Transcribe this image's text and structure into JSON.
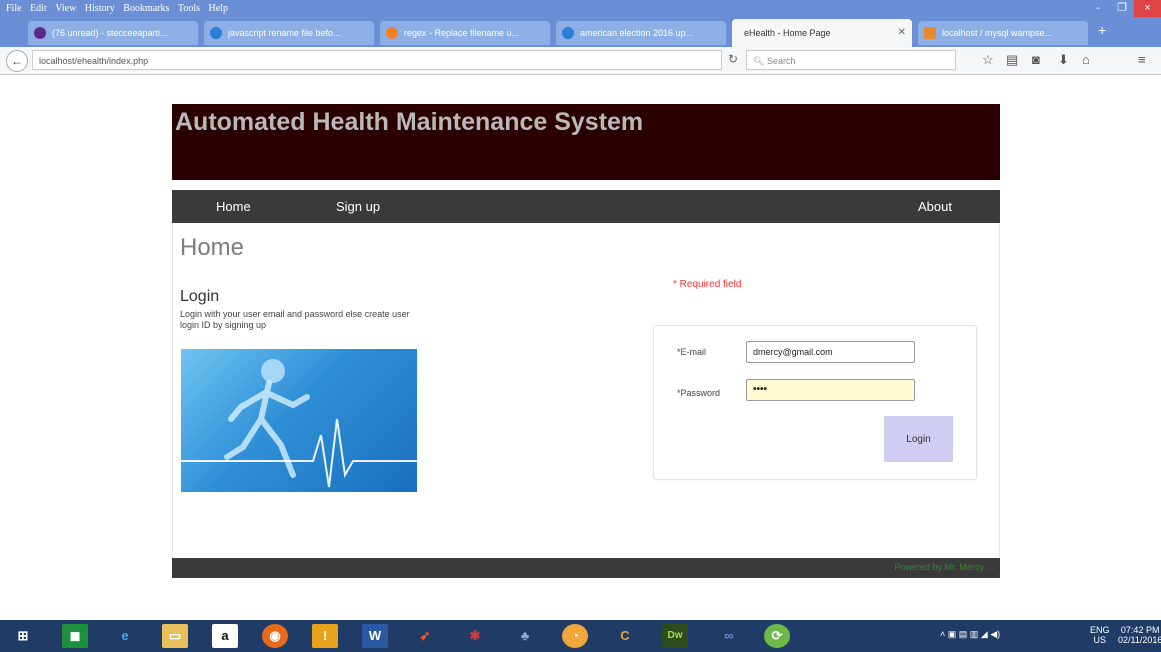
{
  "browser": {
    "menu": [
      "File",
      "Edit",
      "View",
      "History",
      "Bookmarks",
      "Tools",
      "Help"
    ],
    "tabs": [
      {
        "title": "(76 unread) - stecceeaparti..."
      },
      {
        "title": "javascript rename file befo..."
      },
      {
        "title": "regex - Replace filename u..."
      },
      {
        "title": "american election 2016 up..."
      },
      {
        "title": "eHealth - Home Page",
        "active": true
      },
      {
        "title": "localhost / mysql wampse..."
      }
    ],
    "url": "localhost/ehealth/index.php",
    "search_placeholder": "Search",
    "window_controls": [
      "-",
      "❐",
      "×"
    ]
  },
  "site": {
    "title": "Automated Health Maintenance System",
    "nav": {
      "home": "Home",
      "signup": "Sign up",
      "about": "About"
    },
    "page_heading": "Home",
    "login_heading": "Login",
    "login_description": "Login with your user email and password else create user login ID by signing up",
    "required_note": "* Required field",
    "form": {
      "email_label": "*E-mail",
      "email_value": "dmercy@gmail.com",
      "password_label": "*Password",
      "password_value": "••••",
      "login_button": "Login"
    },
    "footer_text": "Powered by Mr. Mercy ..."
  },
  "taskbar": {
    "icons": [
      "windows-start",
      "store",
      "edge",
      "file-explorer",
      "amazon",
      "firefox",
      "acrobat",
      "word",
      "app",
      "app",
      "app",
      "chrome",
      "chrome-canary",
      "dreamweaver",
      "app",
      "app"
    ],
    "lang": "ENG",
    "region": "US",
    "time": "07:42 PM",
    "date": "02/11/2016"
  },
  "colors": {
    "header_bg": "#2a0000",
    "nav_bg": "#3a3a3a",
    "title_text": "#b9b9b9",
    "required": "#ff2a2a",
    "login_button": "#cfcdf2",
    "password_bg": "#fffbd2"
  }
}
